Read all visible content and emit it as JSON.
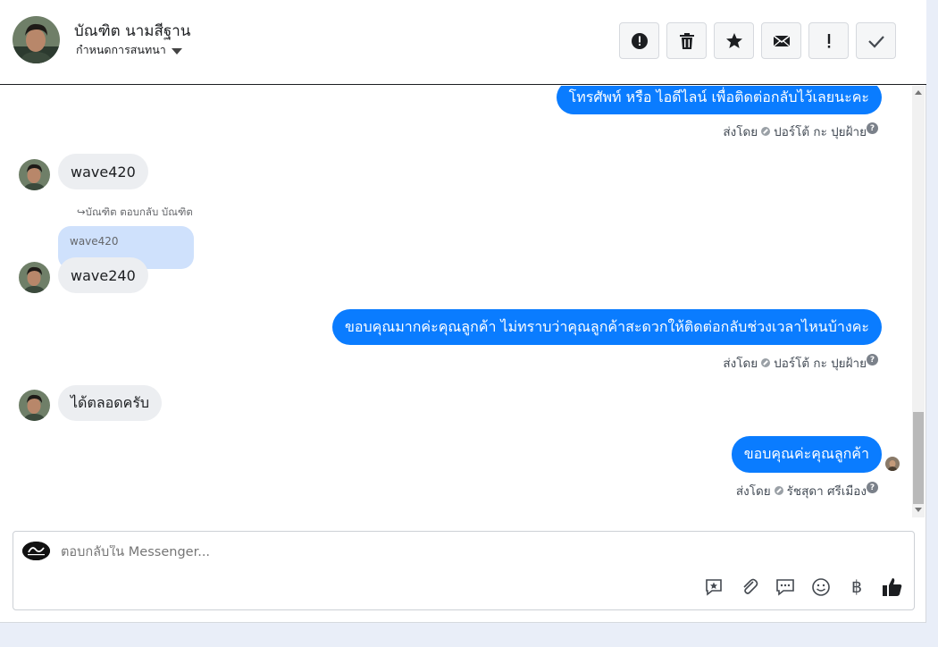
{
  "header": {
    "user_name": "บัณฑิต นามสีฐาน",
    "conversation_label": "กำหนดการสนทนา",
    "tool_icons": [
      "alert-icon",
      "trash-icon",
      "star-icon",
      "mail-icon",
      "exclamation-icon",
      "check-icon"
    ]
  },
  "messages": {
    "m1_text": "โทรศัพท์ หรือ ไอดีไลน์ เพื่อติดต่อกลับไว้เลยนะคะ",
    "m1_meta_prefix": "ส่งโดย",
    "m1_meta_sender": "ปอร์โต้ กะ ปุยฝ้าย",
    "m2_text": "wave420",
    "reply_note": "บัณฑิต ตอบกลับ บัณฑิต",
    "quoted_text": "wave420",
    "m3_text": "wave240",
    "m4_text": "ขอบคุณมากค่ะคุณลูกค้า ไม่ทราบว่าคุณลูกค้าสะดวกให้ติดต่อกลับช่วงเวลาไหนบ้างคะ",
    "m4_meta_prefix": "ส่งโดย",
    "m4_meta_sender": "ปอร์โต้ กะ ปุยฝ้าย",
    "m5_text": "ได้ตลอดครับ",
    "m6_text": "ขอบคุณค่ะคุณลูกค้า",
    "m6_meta_prefix": "ส่งโดย",
    "m6_meta_sender": "รัชสุดา ศรีเมือง",
    "help_glyph": "?"
  },
  "composer": {
    "placeholder": "ตอบกลับใน Messenger...",
    "tool_icons": [
      "saved-reply-icon",
      "attachment-icon",
      "chat-icon",
      "emoji-icon",
      "baht-icon",
      "like-icon"
    ],
    "baht_glyph": "฿"
  },
  "colors": {
    "outgoing_bubble": "#0a7cff",
    "incoming_bubble": "#eceef1",
    "quoted_bubble": "#cfe1fc"
  }
}
